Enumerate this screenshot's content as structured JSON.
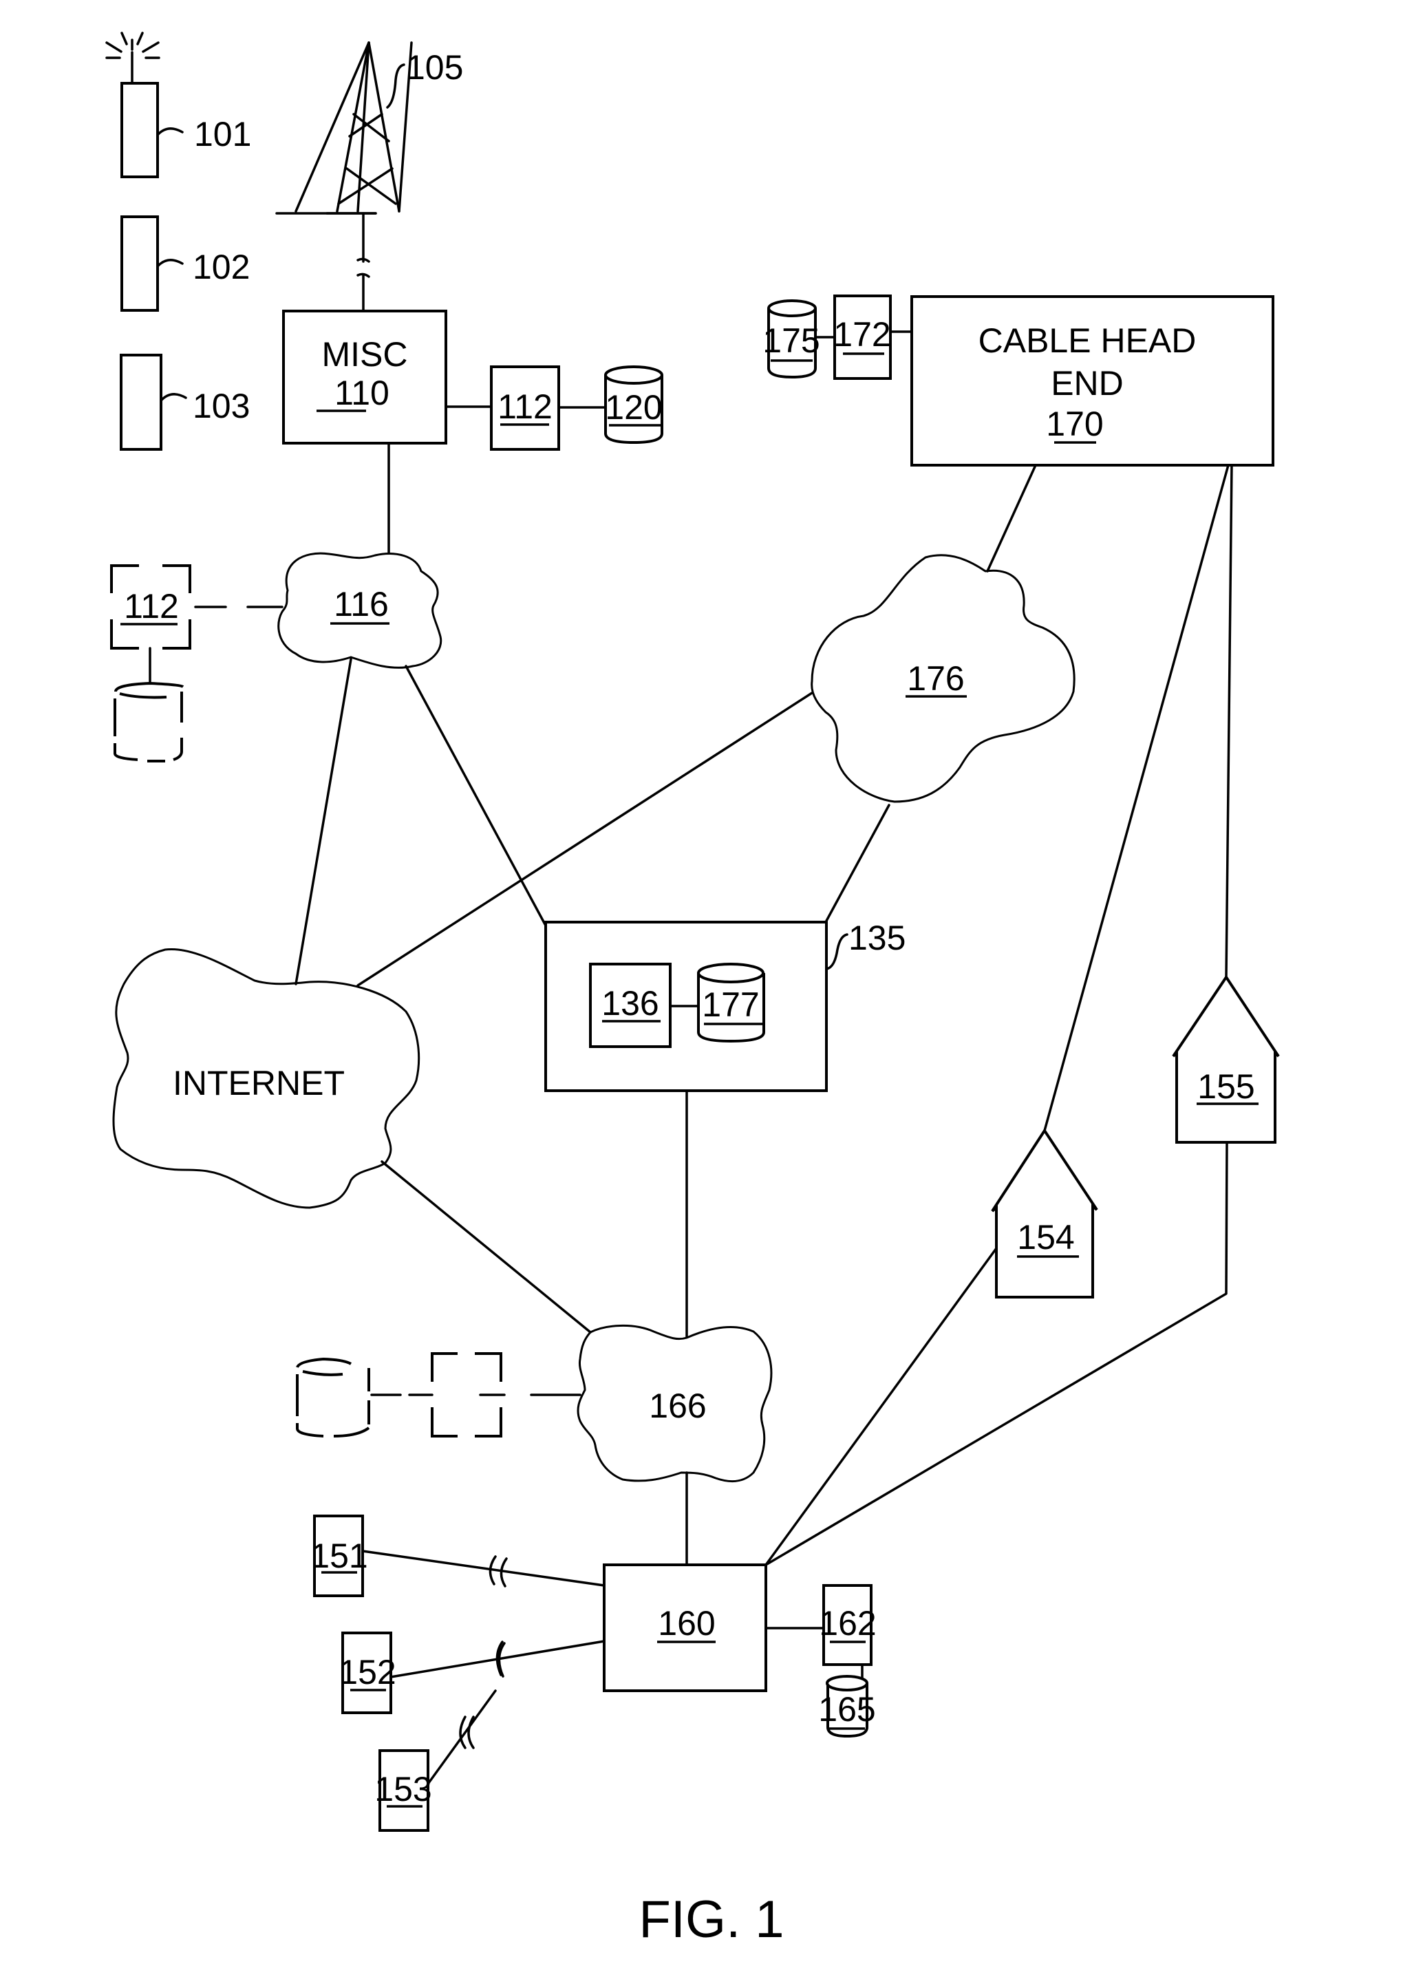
{
  "figure": {
    "caption": "FIG. 1",
    "colors": {
      "line": "#000000",
      "background": "#ffffff"
    }
  },
  "devices": {
    "d101": {
      "ref": "101"
    },
    "d102": {
      "ref": "102"
    },
    "d103": {
      "ref": "103"
    },
    "tower": {
      "ref": "105"
    }
  },
  "misc": {
    "title": "MISC",
    "ref": "110"
  },
  "server112": {
    "ref": "112"
  },
  "db120": {
    "ref": "120"
  },
  "network116": {
    "ref": "116"
  },
  "server112_optional": {
    "ref": "112"
  },
  "headend": {
    "title_line1": "CABLE HEAD",
    "title_line2": "END",
    "ref": "170"
  },
  "server172": {
    "ref": "172"
  },
  "db175": {
    "ref": "175"
  },
  "network176": {
    "ref": "176"
  },
  "platform": {
    "ref": "135"
  },
  "server136": {
    "ref": "136"
  },
  "db177": {
    "ref": "177"
  },
  "internet": {
    "label": "INTERNET"
  },
  "home154": {
    "ref": "154"
  },
  "home155": {
    "ref": "155"
  },
  "network166": {
    "ref": "166"
  },
  "gateway160": {
    "ref": "160"
  },
  "terminal151": {
    "ref": "151"
  },
  "terminal152": {
    "ref": "152"
  },
  "terminal153": {
    "ref": "153"
  },
  "server162": {
    "ref": "162"
  },
  "db165": {
    "ref": "165"
  }
}
